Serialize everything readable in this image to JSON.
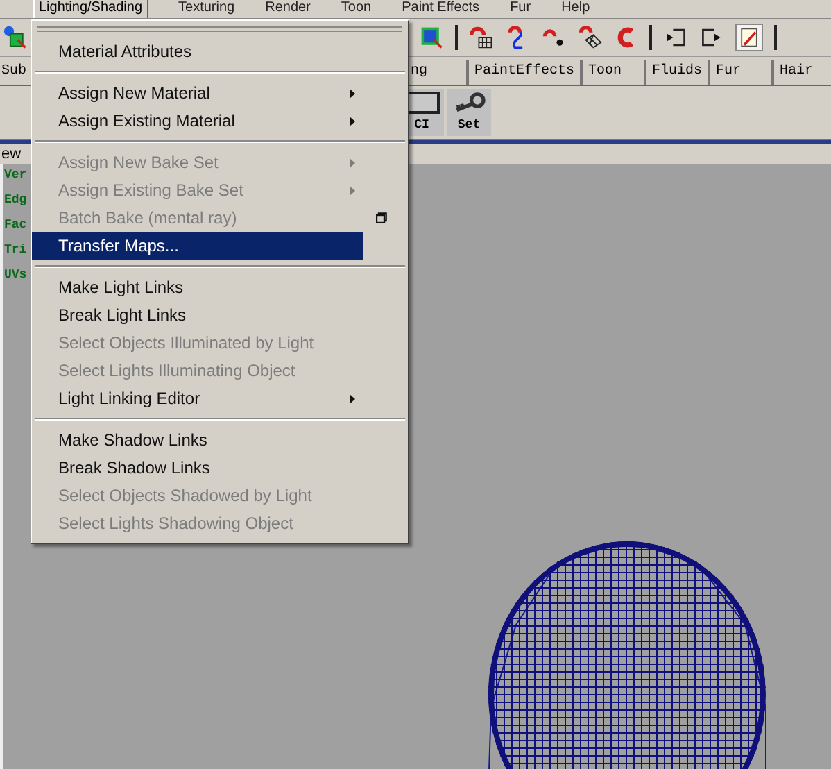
{
  "menu_bar": [
    {
      "label": "Lighting/Shading",
      "selected": true
    },
    {
      "label": "Texturing",
      "selected": false
    },
    {
      "label": "Render",
      "selected": false
    },
    {
      "label": "Toon",
      "selected": false
    },
    {
      "label": "Paint Effects",
      "selected": false
    },
    {
      "label": "Fur",
      "selected": false
    },
    {
      "label": "Help",
      "selected": false
    }
  ],
  "shelf_tabs": [
    {
      "label": "Sub"
    },
    {
      "label": "ng"
    },
    {
      "label": "PaintEffects"
    },
    {
      "label": "Toon"
    },
    {
      "label": "Fluids"
    },
    {
      "label": "Fur"
    },
    {
      "label": "Hair"
    }
  ],
  "shelf_buttons": [
    {
      "label": "CI"
    },
    {
      "label": "Set"
    }
  ],
  "panel_menu": {
    "label": "ew"
  },
  "hud_labels": [
    "Ver",
    "Edg",
    "Fac",
    "Tri",
    "UVs"
  ],
  "dropdown": [
    {
      "kind": "item",
      "label": "Material Attributes",
      "disabled": false,
      "submenu": false,
      "option_box": false,
      "selected": false
    },
    {
      "kind": "separator"
    },
    {
      "kind": "item",
      "label": "Assign New Material",
      "disabled": false,
      "submenu": true,
      "option_box": false,
      "selected": false
    },
    {
      "kind": "item",
      "label": "Assign Existing Material",
      "disabled": false,
      "submenu": true,
      "option_box": false,
      "selected": false
    },
    {
      "kind": "separator"
    },
    {
      "kind": "item",
      "label": "Assign New Bake Set",
      "disabled": true,
      "submenu": true,
      "option_box": false,
      "selected": false
    },
    {
      "kind": "item",
      "label": "Assign Existing Bake Set",
      "disabled": true,
      "submenu": true,
      "option_box": false,
      "selected": false
    },
    {
      "kind": "item",
      "label": "Batch Bake (mental ray)",
      "disabled": true,
      "submenu": false,
      "option_box": true,
      "selected": false
    },
    {
      "kind": "item",
      "label": "Transfer Maps...",
      "disabled": false,
      "submenu": false,
      "option_box": false,
      "selected": true
    },
    {
      "kind": "separator"
    },
    {
      "kind": "item",
      "label": "Make Light Links",
      "disabled": false,
      "submenu": false,
      "option_box": false,
      "selected": false
    },
    {
      "kind": "item",
      "label": "Break Light Links",
      "disabled": false,
      "submenu": false,
      "option_box": false,
      "selected": false
    },
    {
      "kind": "item",
      "label": "Select Objects Illuminated by Light",
      "disabled": true,
      "submenu": false,
      "option_box": false,
      "selected": false
    },
    {
      "kind": "item",
      "label": "Select Lights Illuminating Object",
      "disabled": true,
      "submenu": false,
      "option_box": false,
      "selected": false
    },
    {
      "kind": "item",
      "label": "Light Linking Editor",
      "disabled": false,
      "submenu": true,
      "option_box": false,
      "selected": false
    },
    {
      "kind": "separator"
    },
    {
      "kind": "item",
      "label": "Make Shadow Links",
      "disabled": false,
      "submenu": false,
      "option_box": false,
      "selected": false
    },
    {
      "kind": "item",
      "label": "Break Shadow Links",
      "disabled": false,
      "submenu": false,
      "option_box": false,
      "selected": false
    },
    {
      "kind": "item",
      "label": "Select Objects Shadowed by Light",
      "disabled": true,
      "submenu": false,
      "option_box": false,
      "selected": false
    },
    {
      "kind": "item",
      "label": "Select Lights Shadowing Object",
      "disabled": true,
      "submenu": false,
      "option_box": false,
      "selected": false
    }
  ]
}
